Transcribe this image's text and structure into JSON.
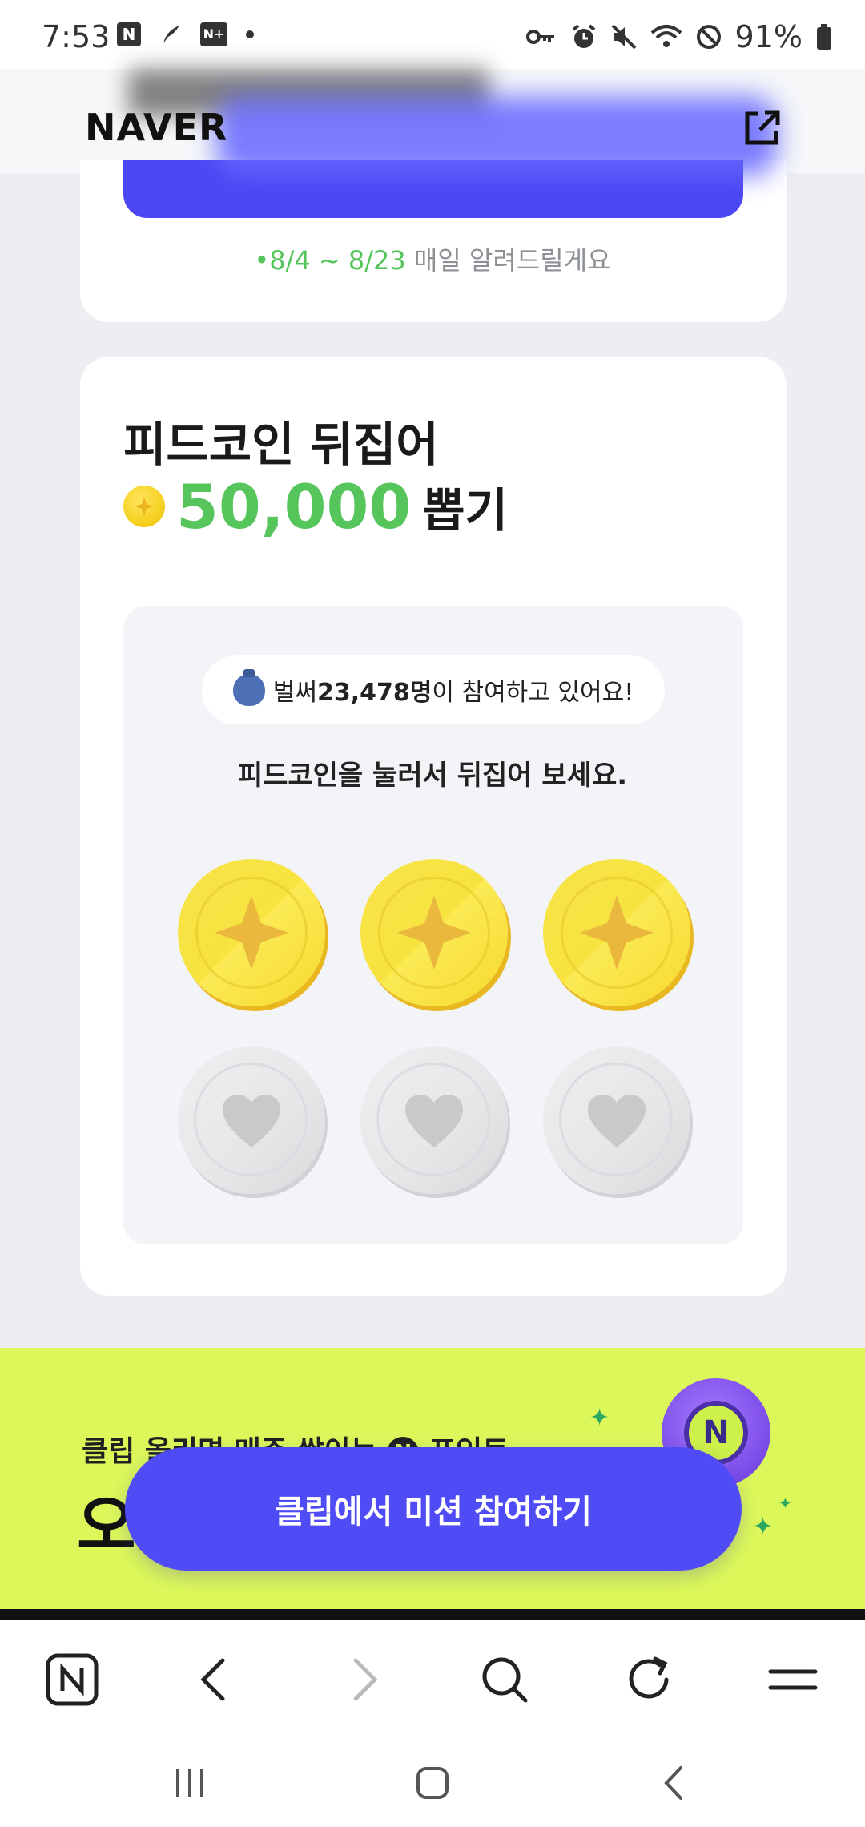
{
  "status_bar": {
    "time": "7:53",
    "battery": "91%",
    "left_icons": [
      "naver-icon",
      "feather-icon",
      "naver-plus-icon",
      "dot-icon"
    ],
    "right_icons": [
      "key-icon",
      "alarm-icon",
      "mute-icon",
      "wifi-icon",
      "dnd-icon",
      "battery-icon"
    ]
  },
  "header": {
    "logo": "NAVER",
    "share_icon": "external-link-icon"
  },
  "event_dates": {
    "range": "•8/4 ~ 8/23",
    "text": " 매일 알려드릴게요"
  },
  "coin_game": {
    "title_line1": "피드코인 뒤집어",
    "amount": "50,000",
    "amount_suffix": "뽑기",
    "participants_prefix": "벌써 ",
    "participants_count": "23,478명",
    "participants_suffix": "이 참여하고 있어요!",
    "instruction": "피드코인을 눌러서 뒤집어 보세요."
  },
  "banner": {
    "line1_before": "클립 올리면 매주 쌓이는 ",
    "line1_after": " 포인트",
    "badge": "N",
    "big_text": "오",
    "coin_badge": "N"
  },
  "cta": {
    "label": "클립에서 미션 참여하기"
  },
  "colors": {
    "accent": "#4f4bf5",
    "green": "#55c55c",
    "banner": "#dbf75a"
  }
}
